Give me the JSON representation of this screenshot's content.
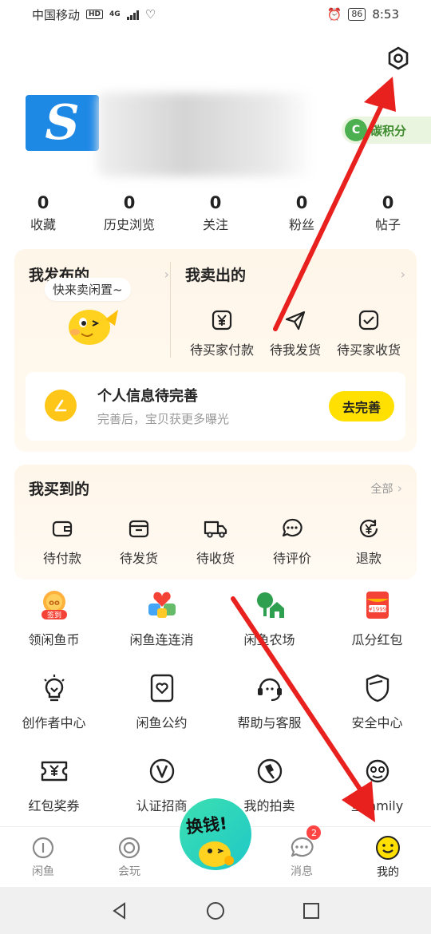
{
  "status_bar": {
    "carrier": "中国移动",
    "hd": "HD",
    "network": "4G",
    "battery": "86",
    "time": "8:53"
  },
  "profile": {
    "carbon_label": "碳积分",
    "carbon_icon_letter": "C"
  },
  "stats": [
    {
      "num": "0",
      "label": "收藏"
    },
    {
      "num": "0",
      "label": "历史浏览"
    },
    {
      "num": "0",
      "label": "关注"
    },
    {
      "num": "0",
      "label": "粉丝"
    },
    {
      "num": "0",
      "label": "帖子"
    }
  ],
  "published": {
    "title": "我发布的",
    "bubble": "快来卖闲置~"
  },
  "sold": {
    "title": "我卖出的",
    "items": [
      {
        "label": "待买家付款",
        "icon": "yen-check-icon"
      },
      {
        "label": "待我发货",
        "icon": "paper-plane-icon"
      },
      {
        "label": "待买家收货",
        "icon": "check-box-icon"
      }
    ]
  },
  "info_panel": {
    "title": "个人信息待完善",
    "subtitle": "完善后，宝贝获更多曝光",
    "button": "去完善"
  },
  "bought": {
    "title": "我买到的",
    "all_label": "全部",
    "items": [
      {
        "label": "待付款",
        "icon": "wallet-icon"
      },
      {
        "label": "待发货",
        "icon": "package-icon"
      },
      {
        "label": "待收货",
        "icon": "truck-icon"
      },
      {
        "label": "待评价",
        "icon": "chat-icon"
      },
      {
        "label": "退款",
        "icon": "refund-icon"
      }
    ]
  },
  "grid": [
    [
      {
        "label": "领闲鱼币",
        "icon": "coin-icon",
        "tag": "签到"
      },
      {
        "label": "闲鱼连连消",
        "icon": "hearts-icon"
      },
      {
        "label": "闲鱼农场",
        "icon": "farm-icon"
      },
      {
        "label": "瓜分红包",
        "icon": "red-packet-icon",
        "tag": "¥1999"
      }
    ],
    [
      {
        "label": "创作者中心",
        "icon": "lightbulb-icon"
      },
      {
        "label": "闲鱼公约",
        "icon": "heart-doc-icon"
      },
      {
        "label": "帮助与客服",
        "icon": "headset-icon"
      },
      {
        "label": "安全中心",
        "icon": "shield-icon"
      }
    ],
    [
      {
        "label": "红包奖券",
        "icon": "ticket-icon"
      },
      {
        "label": "认证招商",
        "icon": "v-badge-icon"
      },
      {
        "label": "我的拍卖",
        "icon": "gavel-icon"
      },
      {
        "label": "鱼family",
        "icon": "fish-family-icon"
      }
    ]
  ],
  "tabbar": {
    "items": [
      {
        "label": "闲鱼",
        "icon": "home-icon"
      },
      {
        "label": "会玩",
        "icon": "circle-play-icon"
      },
      {
        "label": "",
        "icon": ""
      },
      {
        "label": "消息",
        "icon": "message-icon",
        "badge": "2"
      },
      {
        "label": "我的",
        "icon": "smile-icon"
      }
    ],
    "center_label": "换钱!"
  },
  "colors": {
    "accent": "#ffe000",
    "card_bg": "#fff6ea",
    "arrow": "#e8211e"
  }
}
